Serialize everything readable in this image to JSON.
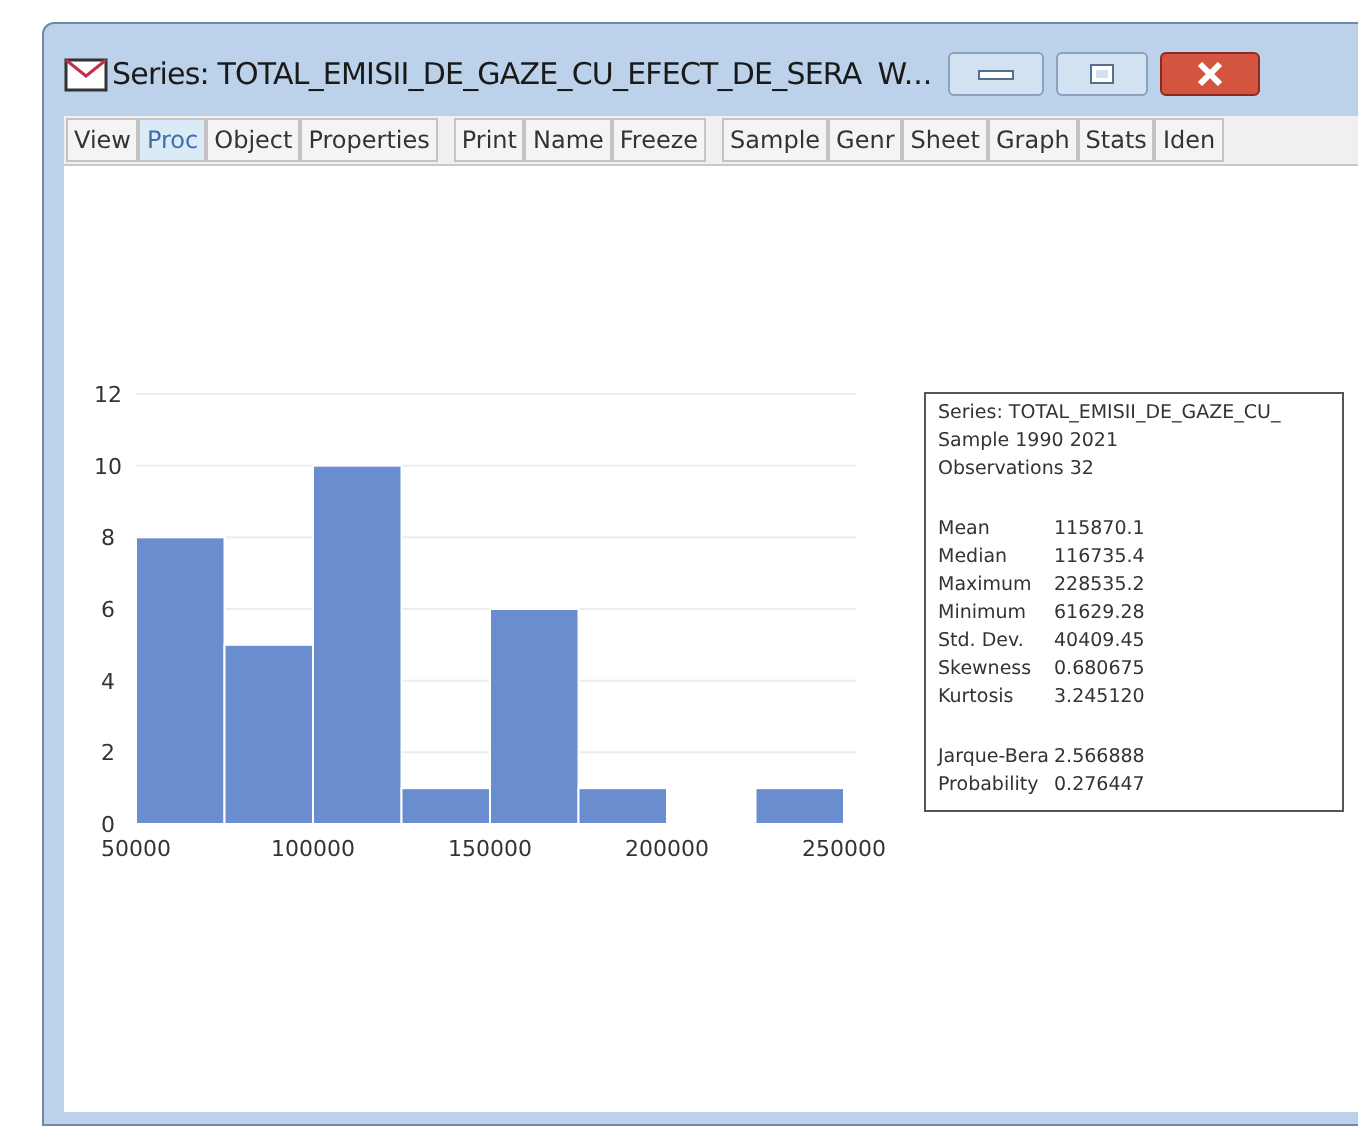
{
  "window": {
    "title": "Series: TOTAL_EMISII_DE_GAZE_CU_EFECT_DE_SERA",
    "title_suffix": "W..."
  },
  "toolbar": {
    "groups": [
      [
        {
          "label": "View",
          "selected": false
        },
        {
          "label": "Proc",
          "selected": true
        },
        {
          "label": "Object",
          "selected": false
        },
        {
          "label": "Properties",
          "selected": false
        }
      ],
      [
        {
          "label": "Print",
          "selected": false
        },
        {
          "label": "Name",
          "selected": false
        },
        {
          "label": "Freeze",
          "selected": false
        }
      ],
      [
        {
          "label": "Sample",
          "selected": false
        },
        {
          "label": "Genr",
          "selected": false
        },
        {
          "label": "Sheet",
          "selected": false
        },
        {
          "label": "Graph",
          "selected": false
        },
        {
          "label": "Stats",
          "selected": false
        },
        {
          "label": "Iden",
          "selected": false
        }
      ]
    ]
  },
  "histogram": {
    "chart_data": {
      "type": "bar",
      "x": [
        62500,
        87500,
        112500,
        137500,
        162500,
        187500,
        212500,
        237500
      ],
      "grid": true,
      "series": [
        {
          "color": "#6a8dcf",
          "values": [
            8,
            5,
            10,
            1,
            6,
            1,
            0,
            1
          ]
        }
      ],
      "xlim": [
        50000,
        250000
      ],
      "ylim": [
        0,
        12
      ],
      "xticks": [
        {
          "value": 50000,
          "label": "50000"
        },
        {
          "value": 100000,
          "label": "100000"
        },
        {
          "value": 150000,
          "label": "150000"
        },
        {
          "value": 200000,
          "label": "200000"
        },
        {
          "value": 250000,
          "label": "250000"
        }
      ],
      "yticks": [
        {
          "value": 0,
          "label": "0"
        },
        {
          "value": 2,
          "label": "2"
        },
        {
          "value": 4,
          "label": "4"
        },
        {
          "value": 6,
          "label": "6"
        },
        {
          "value": 8,
          "label": "8"
        },
        {
          "value": 10,
          "label": "10"
        },
        {
          "value": 12,
          "label": "12"
        }
      ]
    }
  },
  "statistics": {
    "header": [
      "Series: TOTAL_EMISII_DE_GAZE_CU_",
      "Sample 1990 2021",
      "Observations 32"
    ],
    "groups": [
      [
        {
          "label": "Mean",
          "value": "115870.1"
        },
        {
          "label": "Median",
          "value": "116735.4"
        },
        {
          "label": "Maximum",
          "value": "228535.2"
        },
        {
          "label": "Minimum",
          "value": "61629.28"
        },
        {
          "label": "Std. Dev.",
          "value": "40409.45"
        },
        {
          "label": "Skewness",
          "value": "0.680675"
        },
        {
          "label": "Kurtosis",
          "value": "3.245120"
        }
      ],
      [
        {
          "label": "Jarque-Bera",
          "value": "2.566888"
        },
        {
          "label": "Probability",
          "value": "0.276447"
        }
      ]
    ]
  }
}
